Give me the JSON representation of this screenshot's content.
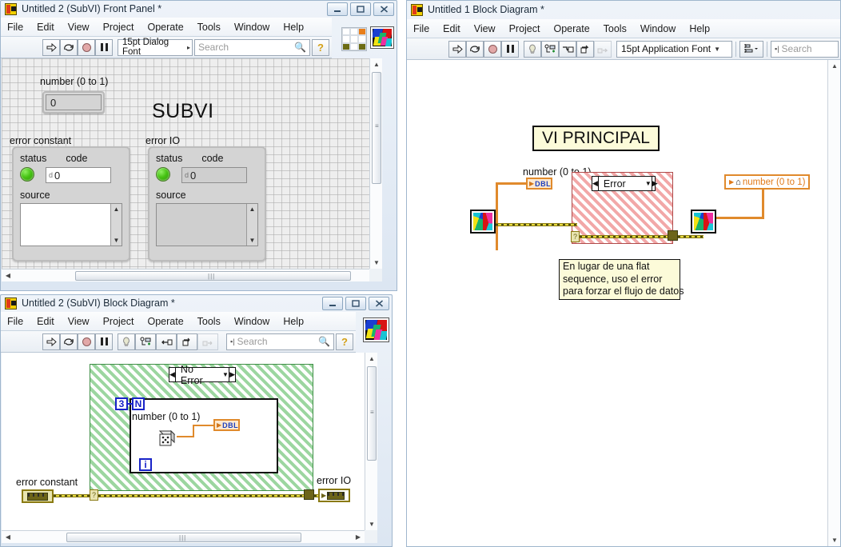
{
  "windows": {
    "front_panel": {
      "title": "Untitled 2 (SubVI) Front Panel *",
      "icon": "labview-vi-icon",
      "menu": [
        "File",
        "Edit",
        "View",
        "Project",
        "Operate",
        "Tools",
        "Window",
        "Help"
      ],
      "toolbar": {
        "run_label": "run-arrow-icon",
        "run_continuous_label": "run-continuously-icon",
        "abort_label": "abort-execution-icon",
        "pause_label": "pause-icon",
        "font": "15pt Dialog Font",
        "search_placeholder": "Search",
        "help_label": "context-help-icon"
      },
      "buttons": {
        "minimize": "–",
        "maximize": "□",
        "close": "✕"
      },
      "controls": {
        "number_label": "number (0 to 1)",
        "number_value": "0",
        "title_label": "SUBVI",
        "error_constant": {
          "label": "error constant",
          "status_label": "status",
          "code_label": "code",
          "code_prefix": "d",
          "code_value": "0",
          "source_label": "source",
          "source_value": ""
        },
        "error_io": {
          "label": "error IO",
          "status_label": "status",
          "code_label": "code",
          "code_prefix": "d",
          "code_value": "0",
          "source_label": "source",
          "source_value": ""
        }
      }
    },
    "subvi_diagram": {
      "title": "Untitled 2 (SubVI) Block Diagram *",
      "menu": [
        "File",
        "Edit",
        "View",
        "Project",
        "Operate",
        "Tools",
        "Window",
        "Help"
      ],
      "toolbar": {
        "search_placeholder": "Search",
        "highlight_label": "highlight-execution-icon",
        "retain_label": "retain-wire-values-icon",
        "step_into_label": "step-into-icon",
        "step_over_label": "step-over-icon",
        "step_out_label": "step-out-icon"
      },
      "buttons": {
        "minimize": "–",
        "maximize": "□",
        "close": "✕"
      },
      "diagram": {
        "case_selector": "No Error",
        "for_count": "3",
        "for_n": "N",
        "for_i": "i",
        "dbl_terminal": "DBL",
        "number_label": "number (0 to 1)",
        "error_constant_label": "error constant",
        "error_io_label": "error IO"
      }
    },
    "main_diagram": {
      "title": "Untitled 1 Block Diagram *",
      "menu": [
        "File",
        "Edit",
        "View",
        "Project",
        "Operate",
        "Tools",
        "Window",
        "Help"
      ],
      "toolbar": {
        "font": "15pt Application Font",
        "search_placeholder": "Search",
        "align_label": "align-objects-icon"
      },
      "diagram": {
        "title_label": "VI PRINCIPAL",
        "number_label": "number (0 to 1)",
        "dbl_terminal": "DBL",
        "case_selector": "Error",
        "indicator_label": "number (0 to 1)",
        "comment": "En lugar de una flat\nsequence, uso el error\npara forzar el flujo de datos"
      }
    }
  },
  "colors": {
    "orange_wire": "#e08a2c",
    "error_wire": "#e8dc40",
    "case_red": "#f2a8a8",
    "case_green": "#9cd6a0",
    "label_yellow": "#fcfbd9",
    "led_green": "#46c313"
  }
}
